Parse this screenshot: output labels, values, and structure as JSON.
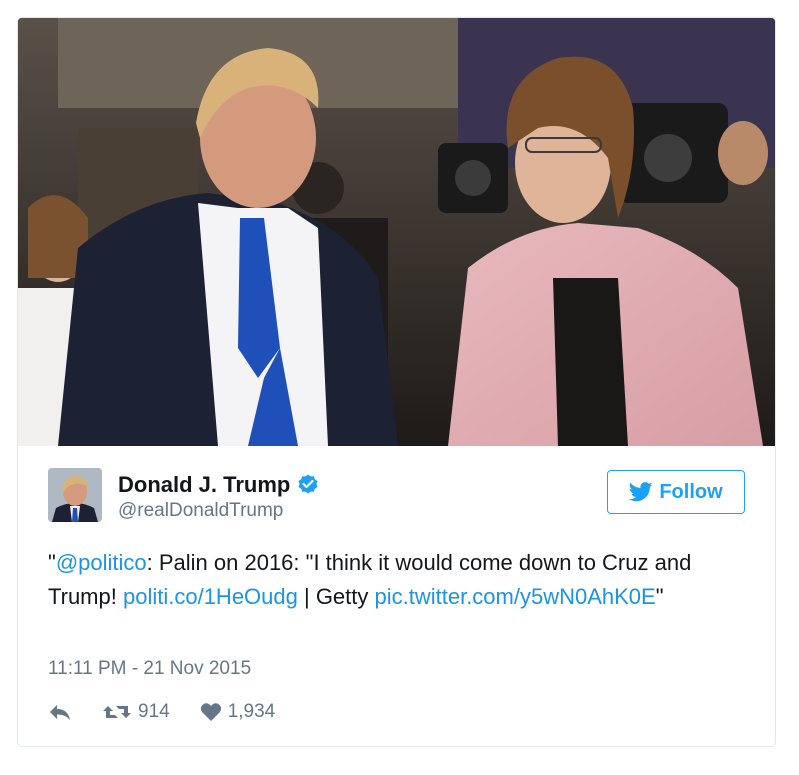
{
  "tweet": {
    "author_name": "Donald J. Trump",
    "handle": "@realDonaldTrump",
    "follow_label": "Follow",
    "text_open_quote": "\"",
    "mention": "@politico",
    "text_part1": ": Palin on 2016: \"I think it would come down to Cruz and Trump! ",
    "link1": "politi.co/1HeOudg",
    "text_part2": " | Getty ",
    "link2": "pic.twitter.com/y5wN0AhK0E",
    "text_close_quote": "\"",
    "timestamp": "11:11 PM - 21 Nov 2015",
    "retweet_count": "914",
    "like_count": "1,934"
  },
  "colors": {
    "link": "#1b95e0",
    "follow_blue": "#1da1f2",
    "muted": "#657786",
    "text": "#14171a"
  },
  "icons": {
    "verified": "verified-badge-icon",
    "twitter": "twitter-bird-icon",
    "reply": "reply-icon",
    "retweet": "retweet-icon",
    "like": "heart-icon"
  }
}
